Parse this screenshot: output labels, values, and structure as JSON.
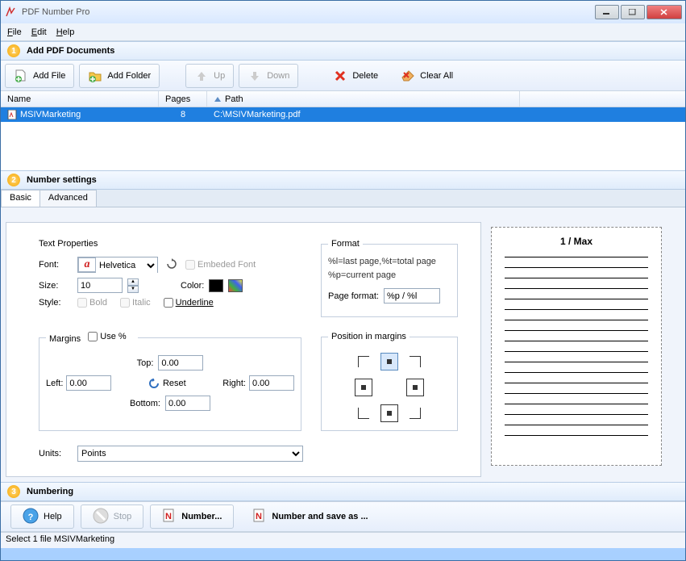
{
  "title": "PDF Number Pro",
  "menu": {
    "file": "File",
    "edit": "Edit",
    "help": "Help"
  },
  "section1": {
    "num": "1",
    "label": "Add PDF Documents"
  },
  "toolbar1": {
    "addfile": "Add File",
    "addfolder": "Add Folder",
    "up": "Up",
    "down": "Down",
    "delete": "Delete",
    "clearall": "Clear All"
  },
  "cols": {
    "name": "Name",
    "pages": "Pages",
    "path": "Path"
  },
  "row": {
    "name": "MSIVMarketing",
    "pages": "8",
    "path": "C:\\MSIVMarketing.pdf"
  },
  "section2": {
    "num": "2",
    "label": "Number settings"
  },
  "tabs": {
    "basic": "Basic",
    "advanced": "Advanced"
  },
  "textprops": {
    "legend": "Text Properties",
    "font": "Font:",
    "fontvalue": "Helvetica",
    "embed": "Embeded Font",
    "size": "Size:",
    "sizevalue": "10",
    "color": "Color:",
    "style": "Style:",
    "bold": "Bold",
    "italic": "Italic",
    "underline": "Underline"
  },
  "format": {
    "legend": "Format",
    "hint1": "%l=last page,%t=total page",
    "hint2": "%p=current page",
    "pagelabel": "Page format:",
    "pagevalue": "%p / %l"
  },
  "margins": {
    "legend": "Margins",
    "usepct": "Use %",
    "top": "Top:",
    "topv": "0.00",
    "left": "Left:",
    "leftv": "0.00",
    "reset": "Reset",
    "right": "Right:",
    "rightv": "0.00",
    "bottom": "Bottom:",
    "bottomv": "0.00"
  },
  "pos": {
    "legend": "Position in margins"
  },
  "units": {
    "label": "Units:",
    "value": "Points"
  },
  "preview": {
    "page": "1 / Max"
  },
  "section3": {
    "num": "3",
    "label": "Numbering"
  },
  "toolbar3": {
    "help": "Help",
    "stop": "Stop",
    "number": "Number...",
    "saveas": "Number and save as ..."
  },
  "status": "Select 1 file MSIVMarketing"
}
